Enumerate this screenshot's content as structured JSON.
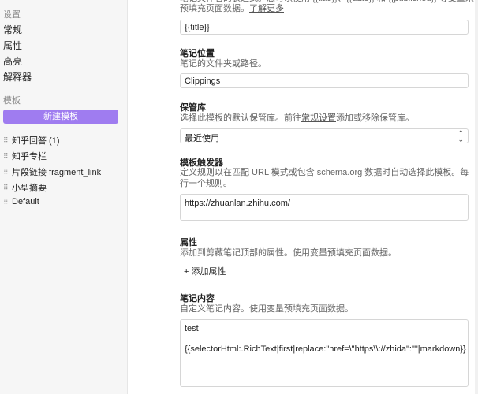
{
  "sidebar": {
    "settings_label": "设置",
    "nav": [
      "常规",
      "属性",
      "高亮",
      "解释器"
    ],
    "templates_label": "模板",
    "new_template_button": "新建模板",
    "templates": [
      "知乎回答 (1)",
      "知乎专栏",
      "片段链接 fragment_link",
      "小型摘要",
      "Default"
    ]
  },
  "main": {
    "top_partial_text": "笔记文件名的表达式。您可以使用 {{title}}、{{date}} 和 {{published}} 等变量来预填充页面数据。",
    "top_link": "了解更多",
    "title_value": "{{title}}",
    "location": {
      "title": "笔记位置",
      "desc": "笔记的文件夹或路径。",
      "value": "Clippings"
    },
    "vault": {
      "title": "保管库",
      "desc_before": "选择此模板的默认保管库。前往",
      "desc_link": "常规设置",
      "desc_after": "添加或移除保管库。",
      "value": "最近使用"
    },
    "triggers": {
      "title": "模板触发器",
      "desc": "定义规则以在匹配 URL 模式或包含 schema.org 数据时自动选择此模板。每行一个规则。",
      "value": "https://zhuanlan.zhihu.com/"
    },
    "properties": {
      "title": "属性",
      "desc": "添加到剪藏笔记顶部的属性。使用变量预填充页面数据。",
      "add_label": "+ 添加属性"
    },
    "content": {
      "title": "笔记内容",
      "desc": "自定义笔记内容。使用变量预填充页面数据。",
      "value": "test\n\n{{selectorHtml:.RichText|first|replace:\"href=\\\"https\\\\://zhida\":\"\"|markdown}}"
    }
  }
}
